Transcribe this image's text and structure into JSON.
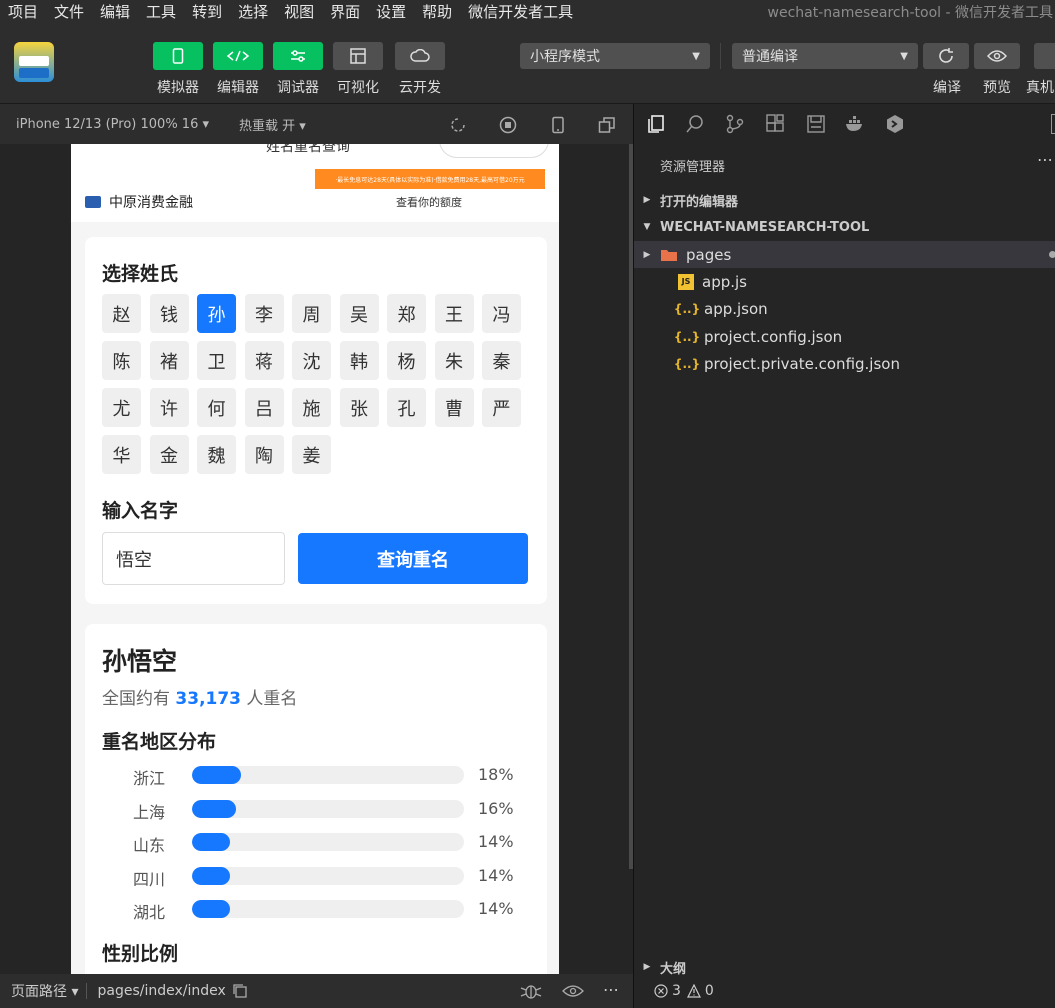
{
  "menu": {
    "items": [
      "项目",
      "文件",
      "编辑",
      "工具",
      "转到",
      "选择",
      "视图",
      "界面",
      "设置",
      "帮助",
      "微信开发者工具"
    ],
    "window_title": "wechat-namesearch-tool - 微信开发者工具"
  },
  "toolbar": {
    "simulator_label": "模拟器",
    "editor_label": "编辑器",
    "debugger_label": "调试器",
    "visual_label": "可视化",
    "cloud_label": "云开发",
    "mode_select": "小程序模式",
    "compile_select": "普通编译",
    "compile_label": "编译",
    "preview_label": "预览",
    "real_label": "真机"
  },
  "simbar": {
    "device": "iPhone 12/13 (Pro) 100% 16 ▾",
    "hotreload": "热重载 开 ▾"
  },
  "ad": {
    "title": "姓名重名查询",
    "banner": "·最长免息可达28天(具体以实际为准)·借款免费用28天,最高可借20万元",
    "brand": "中原消费金融",
    "quota": "查看你的额度"
  },
  "app": {
    "surname_heading": "选择姓氏",
    "surnames": [
      "赵",
      "钱",
      "孙",
      "李",
      "周",
      "吴",
      "郑",
      "王",
      "冯",
      "陈",
      "褚",
      "卫",
      "蒋",
      "沈",
      "韩",
      "杨",
      "朱",
      "秦",
      "尤",
      "许",
      "何",
      "吕",
      "施",
      "张",
      "孔",
      "曹",
      "严",
      "华",
      "金",
      "魏",
      "陶",
      "姜"
    ],
    "selected_surname": "孙",
    "name_heading": "输入名字",
    "name_value": "悟空",
    "query_button": "查询重名",
    "result_name": "孙悟空",
    "result_prefix": "全国约有",
    "result_count": "33,173",
    "result_suffix": "人重名",
    "region_heading": "重名地区分布",
    "regions": [
      {
        "name": "浙江",
        "pct_label": "18%",
        "pct": 18
      },
      {
        "name": "上海",
        "pct_label": "16%",
        "pct": 16
      },
      {
        "name": "山东",
        "pct_label": "14%",
        "pct": 14
      },
      {
        "name": "四川",
        "pct_label": "14%",
        "pct": 14
      },
      {
        "name": "湖北",
        "pct_label": "14%",
        "pct": 14
      }
    ],
    "gender_heading": "性别比例"
  },
  "statusbar": {
    "path_label": "页面路径 ▾",
    "path_value": "pages/index/index",
    "errors": "3",
    "warnings": "0"
  },
  "explorer": {
    "title": "资源管理器",
    "open_editors": "打开的编辑器",
    "project": "WECHAT-NAMESEARCH-TOOL",
    "outline": "大纲",
    "files": [
      {
        "name": "pages",
        "type": "folder"
      },
      {
        "name": "app.js",
        "type": "js"
      },
      {
        "name": "app.json",
        "type": "json"
      },
      {
        "name": "project.config.json",
        "type": "json"
      },
      {
        "name": "project.private.config.json",
        "type": "json"
      }
    ]
  },
  "colors": {
    "accent": "#1677ff",
    "green": "#07c160"
  }
}
